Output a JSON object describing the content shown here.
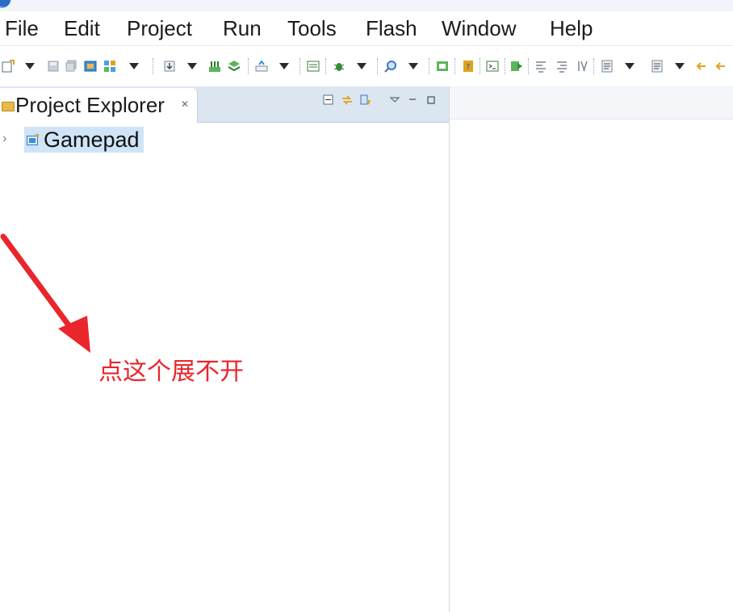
{
  "menu": {
    "items": [
      "File",
      "Edit",
      "Project",
      "Run",
      "Tools",
      "Flash",
      "Window",
      "Help"
    ]
  },
  "project_explorer": {
    "tab_label": "Project Explorer",
    "close_symbol": "✕",
    "tree": [
      {
        "label": "Gamepad",
        "expanded": false,
        "selected": true,
        "icon": "flash-project-icon"
      }
    ]
  },
  "annotation": {
    "text": "点这个展不开",
    "color": "#e8262c"
  },
  "colors": {
    "tab_row_bg": "#dce6f1",
    "selection_bg": "#cfe4f7"
  }
}
